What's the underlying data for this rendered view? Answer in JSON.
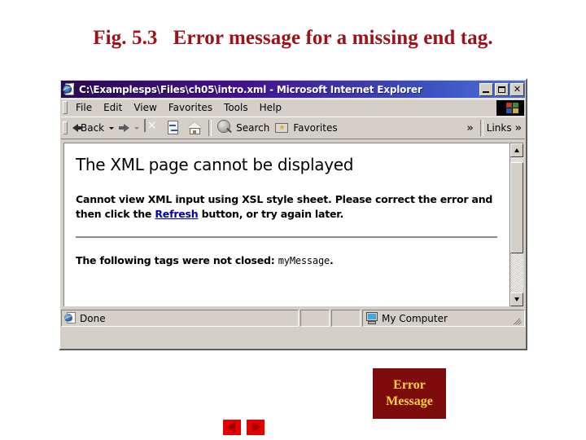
{
  "figure": {
    "caption": "Fig. 5.3   Error message for a missing end tag."
  },
  "browser": {
    "title": "C:\\Examplesps\\Files\\ch05\\intro.xml - Microsoft Internet Explorer",
    "window_buttons": {
      "minimize": "minimize",
      "maximize": "maximize",
      "close": "close"
    },
    "menu": [
      {
        "label": "File"
      },
      {
        "label": "Edit"
      },
      {
        "label": "View"
      },
      {
        "label": "Favorites"
      },
      {
        "label": "Tools"
      },
      {
        "label": "Help"
      }
    ],
    "toolbar": {
      "back": "Back",
      "forward": "",
      "stop": "Stop",
      "refresh": "Refresh",
      "home": "Home",
      "search": "Search",
      "favorites": "Favorites",
      "overflow_chevron": "»",
      "links": "Links",
      "links_chevron": "»"
    },
    "page": {
      "heading": "The XML page cannot be displayed",
      "paragraph_before_link": "Cannot view XML input using XSL style sheet. Please correct the error and then click the ",
      "link": "Refresh",
      "paragraph_after_link": " button, or try again later.",
      "detail_prefix": "The following tags were not closed: ",
      "detail_tag": "myMessage",
      "detail_suffix": "."
    },
    "statusbar": {
      "status": "Done",
      "zone": "My Computer"
    }
  },
  "annotation": {
    "line1": "Error",
    "line2": "Message"
  },
  "nav": {
    "previous": "previous-slide",
    "next": "next-slide"
  },
  "colors": {
    "caption_red": "#9e1119",
    "annotation_bg": "#7d0b0b",
    "annotation_text": "#ffd23a",
    "nav_red": "#e60000",
    "nav_arrow": "#a00000",
    "titlebar_start": "#2c0a52",
    "titlebar_end": "#4a73d8",
    "chrome_gray": "#d4d0c8",
    "link_blue": "#0000a0"
  }
}
